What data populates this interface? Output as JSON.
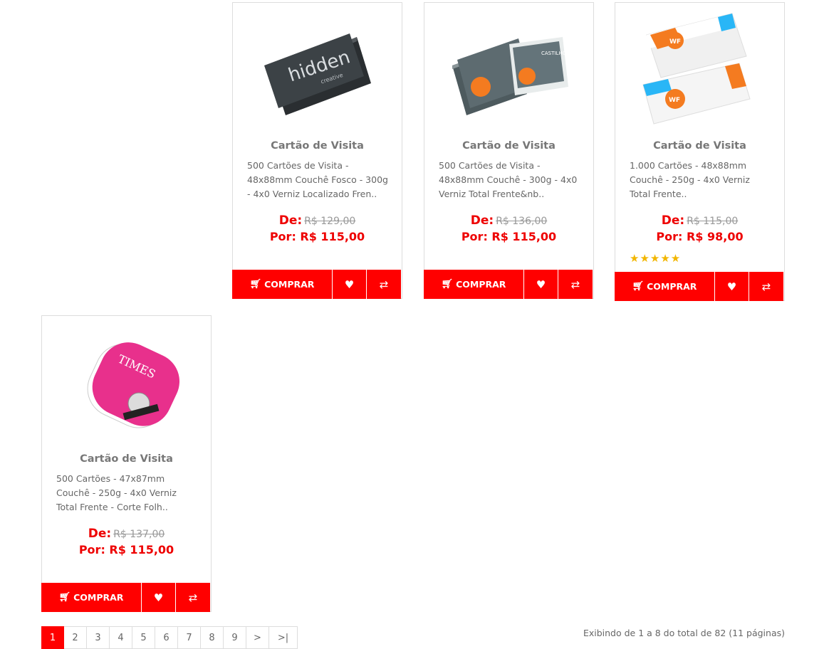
{
  "products": [
    {
      "title": "Cartão de Visita",
      "description": "500 Cartões de Visita - 48x88mm Couchê Fosco - 300g - 4x0 Verniz Localizado Fren..",
      "de_label": "De:",
      "old_price": "R$ 129,00",
      "new_price": "Por: R$ 115,00",
      "image_logo_text": "hidden",
      "image_sub_text": "creative"
    },
    {
      "title": "Cartão de Visita",
      "description": "500 Cartões de Visita - 48x88mm Couchê - 300g - 4x0 Verniz Total Frente&nb..",
      "de_label": "De:",
      "old_price": "R$ 136,00",
      "new_price": "Por: R$ 115,00"
    },
    {
      "title": "Cartão de Visita",
      "description": "1.000 Cartões - 48x88mm Couchê - 250g - 4x0 Verniz Total Frente..",
      "de_label": "De:",
      "old_price": "R$ 115,00",
      "new_price": "Por: R$ 98,00",
      "stars": "★★★★★",
      "rating": 5,
      "image_logo_text": "WF"
    },
    {
      "title": "Cartão de Visita",
      "description": "500 Cartões - 47x87mm Couchê - 250g - 4x0 Verniz Total Frente - Corte Folh..",
      "de_label": "De:",
      "old_price": "R$ 137,00",
      "new_price": "Por: R$ 115,00",
      "image_logo_text": "TIMES"
    }
  ],
  "buttons": {
    "buy_label": "COMPRAR",
    "cart_icon": "cart-icon",
    "wishlist_icon": "heart-icon",
    "compare_icon": "compare-icon"
  },
  "pagination": {
    "pages": [
      "1",
      "2",
      "3",
      "4",
      "5",
      "6",
      "7",
      "8",
      "9",
      ">",
      ">|"
    ],
    "active": "1"
  },
  "results_text": "Exibindo de 1 a 8 do total de 82 (11 páginas)",
  "colors": {
    "accent": "#ff0000",
    "price": "#ee0000",
    "star": "#f2b600"
  }
}
